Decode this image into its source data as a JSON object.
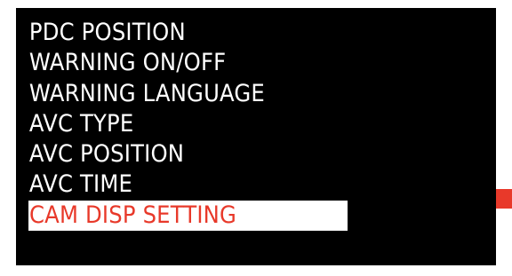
{
  "menu": {
    "items": [
      {
        "label": "PDC POSITION",
        "selected": false
      },
      {
        "label": "WARNING ON/OFF",
        "selected": false
      },
      {
        "label": "WARNING LANGUAGE",
        "selected": false
      },
      {
        "label": "AVC TYPE",
        "selected": false
      },
      {
        "label": "AVC POSITION",
        "selected": false
      },
      {
        "label": "AVC TIME",
        "selected": false
      },
      {
        "label": "CAM DISP SETTING",
        "selected": true
      }
    ]
  },
  "colors": {
    "background": "#000000",
    "text": "#ffffff",
    "highlight_bg": "#ffffff",
    "highlight_text": "#e8392a",
    "scroll_indicator": "#e8392a"
  }
}
